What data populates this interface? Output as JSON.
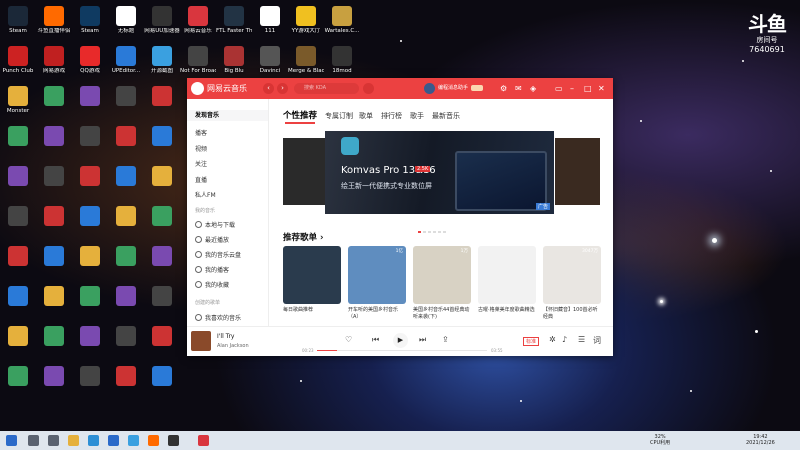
{
  "watermark": {
    "brand": "斗鱼",
    "sub": "房间号",
    "room": "7640691"
  },
  "desktop_icons": [
    {
      "label": "Steam",
      "color": "#1b2838"
    },
    {
      "label": "斗鱼直播伴侣",
      "color": "#ff6a00"
    },
    {
      "label": "Steam",
      "color": "#0f3a61"
    },
    {
      "label": "无标题",
      "color": "#ffffff"
    },
    {
      "label": "网易UU加速器",
      "color": "#333333"
    },
    {
      "label": "网易云音乐",
      "color": "#d9363e"
    },
    {
      "label": "FTL Faster Than Light",
      "color": "#223344"
    },
    {
      "label": "111",
      "color": "#ffffff"
    },
    {
      "label": "YY游戏大厅",
      "color": "#f0c020"
    },
    {
      "label": "Wartales.C...",
      "color": "#c8a040"
    },
    {
      "label": "Punch Club",
      "color": "#cc2222"
    },
    {
      "label": "网易游戏",
      "color": "#c02020"
    },
    {
      "label": "QQ游戏",
      "color": "#e82a2a"
    },
    {
      "label": "UPEditor...",
      "color": "#2a7ad8"
    },
    {
      "label": "开源截图",
      "color": "#3aa0e0"
    },
    {
      "label": "Not For Broadcast",
      "color": "#444444"
    },
    {
      "label": "Big Blu",
      "color": "#aa3333"
    },
    {
      "label": "Davinci",
      "color": "#555555"
    },
    {
      "label": "Merge & Blade",
      "color": "#7a5a2a"
    },
    {
      "label": "18mod",
      "color": "#333333"
    },
    {
      "label": "Monster",
      "color": "#4a4a4a"
    }
  ],
  "app": {
    "title": "网易云音乐",
    "nav_back": "‹",
    "nav_forward": "›",
    "search_placeholder": "搜索 KDA",
    "user": {
      "name": "编程消息助手"
    },
    "top_icons": [
      "gear-icon",
      "mail-icon",
      "shirt-icon",
      "minimize-icon",
      "maximize-icon",
      "close-icon"
    ]
  },
  "sidebar": {
    "items": [
      {
        "label": "发现音乐",
        "active": true
      },
      {
        "label": "播客"
      },
      {
        "label": "视频"
      },
      {
        "label": "关注"
      },
      {
        "label": "直播"
      },
      {
        "label": "私人FM"
      }
    ],
    "my_header": "我的音乐",
    "my_items": [
      {
        "label": "本地与下载",
        "icon": "download-icon"
      },
      {
        "label": "最近播放",
        "icon": "clock-icon"
      },
      {
        "label": "我的音乐云盘",
        "icon": "cloud-icon"
      },
      {
        "label": "我的播客",
        "icon": "radio-icon"
      },
      {
        "label": "我的收藏",
        "icon": "star-icon"
      }
    ],
    "created_header": "创建的歌单",
    "created_items": [
      {
        "label": "我喜欢的音乐",
        "icon": "heart-icon"
      }
    ]
  },
  "tabs": [
    "个性推荐",
    "专属订制",
    "歌单",
    "排行榜",
    "歌手",
    "最新音乐"
  ],
  "banner": {
    "title": "Komvas Pro 13&16",
    "badge": "2.5K",
    "subtitle": "绘王新一代便携式专业数位屏",
    "ad": "广告"
  },
  "section": {
    "title": "推荐歌单 ›"
  },
  "playlists": [
    {
      "caption": "每日歌曲推荐",
      "count": "",
      "color": "#2a3b4d"
    },
    {
      "caption": "开车听的美国乡村音乐（A）",
      "count": "1亿",
      "color": "#5f8dbf"
    },
    {
      "caption": "美国乡村音乐44首经典动听来袭(下)",
      "count": "1万",
      "color": "#d8d2c4"
    },
    {
      "caption": "古曜·格莱美年度歌曲精选",
      "count": "",
      "color": "#f2f2f2"
    },
    {
      "caption": "【怀旧藏音】100首必听经典",
      "count": "3047万",
      "color": "#e9e6e2"
    }
  ],
  "player": {
    "song": "I'll Try",
    "artist": "Alan Jackson",
    "time_current": "00:23",
    "time_total": "03:55",
    "quality": "标准"
  },
  "taskbar": {
    "cpu": "32%",
    "cpu_label": "CPU利用",
    "time": "19:42",
    "date": "2021/12/26"
  }
}
